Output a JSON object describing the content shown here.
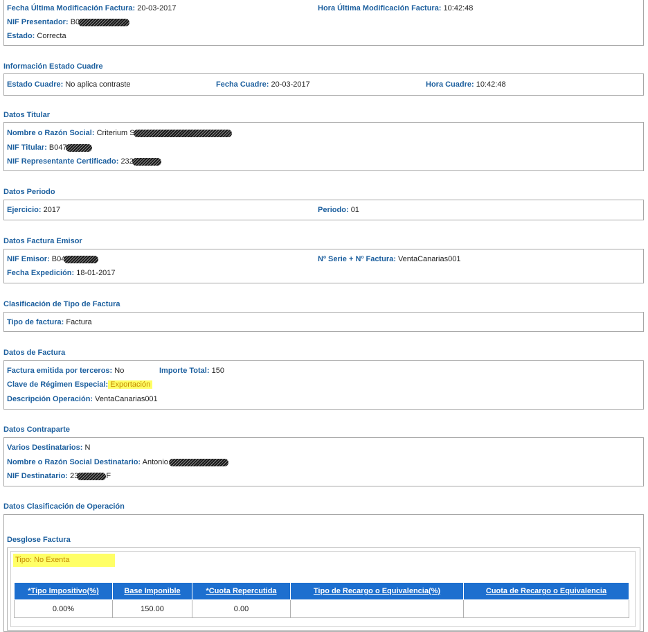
{
  "header_box": {
    "fecha_mod_label": "Fecha Última Modificación Factura:",
    "fecha_mod_value": "20-03-2017",
    "hora_mod_label": "Hora Última Modificación Factura:",
    "hora_mod_value": "10:42:48",
    "nif_presentador_label": "NIF Presentador:",
    "nif_presentador_value": "B0",
    "estado_label": "Estado:",
    "estado_value": "Correcta"
  },
  "estado_cuadre": {
    "title": "Información Estado Cuadre",
    "estado_label": "Estado Cuadre:",
    "estado_value": "No aplica contraste",
    "fecha_label": "Fecha Cuadre:",
    "fecha_value": "20-03-2017",
    "hora_label": "Hora Cuadre:",
    "hora_value": "10:42:48"
  },
  "titular": {
    "title": "Datos Titular",
    "nombre_label": "Nombre o Razón Social:",
    "nombre_value": "Criterium S",
    "nif_label": "NIF Titular:",
    "nif_value": "B047",
    "nif_rep_label": "NIF Representante Certificado:",
    "nif_rep_value": "232"
  },
  "periodo": {
    "title": "Datos Periodo",
    "ejercicio_label": "Ejercicio:",
    "ejercicio_value": "2017",
    "periodo_label": "Periodo:",
    "periodo_value": "01"
  },
  "emisor": {
    "title": "Datos Factura Emisor",
    "nif_label": "NIF Emisor:",
    "nif_value": "B04",
    "serie_label": "Nº Serie + Nº Factura:",
    "serie_value": "VentaCanarias001",
    "fecha_label": "Fecha Expedición:",
    "fecha_value": "18-01-2017"
  },
  "clasificacion": {
    "title": "Clasificación de Tipo de Factura",
    "tipo_label": "Tipo de factura:",
    "tipo_value": "Factura"
  },
  "factura": {
    "title": "Datos de Factura",
    "terceros_label": "Factura emitida por terceros:",
    "terceros_value": "No",
    "importe_label": "Importe Total:",
    "importe_value": "150",
    "clave_label": "Clave de Régimen Especial:",
    "clave_value": "Exportación",
    "descripcion_label": "Descripción Operación:",
    "descripcion_value": "VentaCanarias001"
  },
  "contraparte": {
    "title": "Datos Contraparte",
    "varios_label": "Varios Destinatarios:",
    "varios_value": "N",
    "nombre_label": "Nombre o Razón Social Destinatario:",
    "nombre_value": "Antonio",
    "nif_label": "NIF Destinatario:",
    "nif_value_prefix": "23",
    "nif_value_suffix": "F"
  },
  "operacion": {
    "title": "Datos Clasificación de Operación",
    "desglose_title": "Desglose Factura",
    "tipo_label": "Tipo:",
    "tipo_value": "No Exenta",
    "table": {
      "headers": [
        "*Tipo Impositivo(%)",
        "Base Imponible",
        "*Cuota Repercutida",
        "Tipo de Recargo o Equivalencia(%)",
        "Cuota de Recargo o Equivalencia"
      ],
      "rows": [
        [
          "0.00%",
          "150.00",
          "0.00",
          "",
          ""
        ]
      ]
    }
  },
  "colors": {
    "label_blue": "#1c5f9e",
    "header_blue": "#1d6fcf",
    "highlight_yellow": "#ffff66"
  }
}
